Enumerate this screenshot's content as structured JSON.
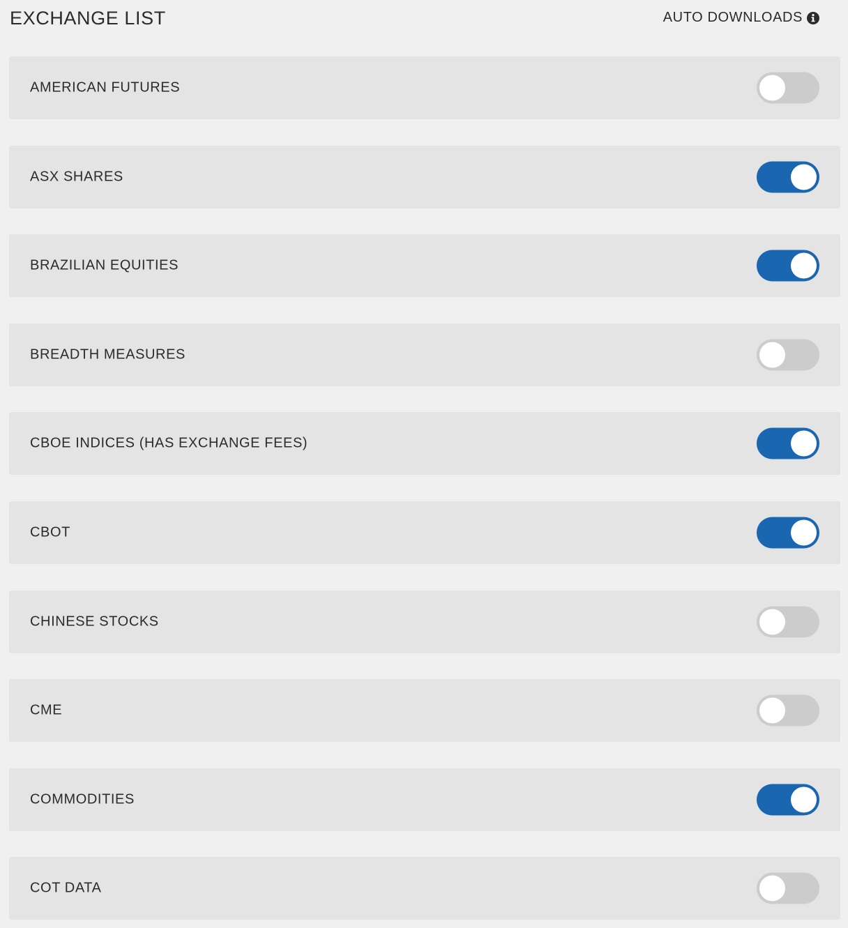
{
  "header": {
    "title": "EXCHANGE LIST",
    "auto_downloads_label": "AUTO DOWNLOADS",
    "info_icon": "info-circle-icon"
  },
  "colors": {
    "background": "#f0f0f0",
    "row_background": "#e4e4e4",
    "toggle_on": "#1a66b0",
    "toggle_off": "#cccccc",
    "knob": "#ffffff",
    "text": "#2b2b2b"
  },
  "exchanges": [
    {
      "label": "AMERICAN FUTURES",
      "enabled": false
    },
    {
      "label": "ASX SHARES",
      "enabled": true
    },
    {
      "label": "BRAZILIAN EQUITIES",
      "enabled": true
    },
    {
      "label": "BREADTH MEASURES",
      "enabled": false
    },
    {
      "label": "CBOE INDICES (HAS EXCHANGE FEES)",
      "enabled": true
    },
    {
      "label": "CBOT",
      "enabled": true
    },
    {
      "label": "CHINESE STOCKS",
      "enabled": false
    },
    {
      "label": "CME",
      "enabled": false
    },
    {
      "label": "COMMODITIES",
      "enabled": true
    },
    {
      "label": "COT DATA",
      "enabled": false
    }
  ]
}
